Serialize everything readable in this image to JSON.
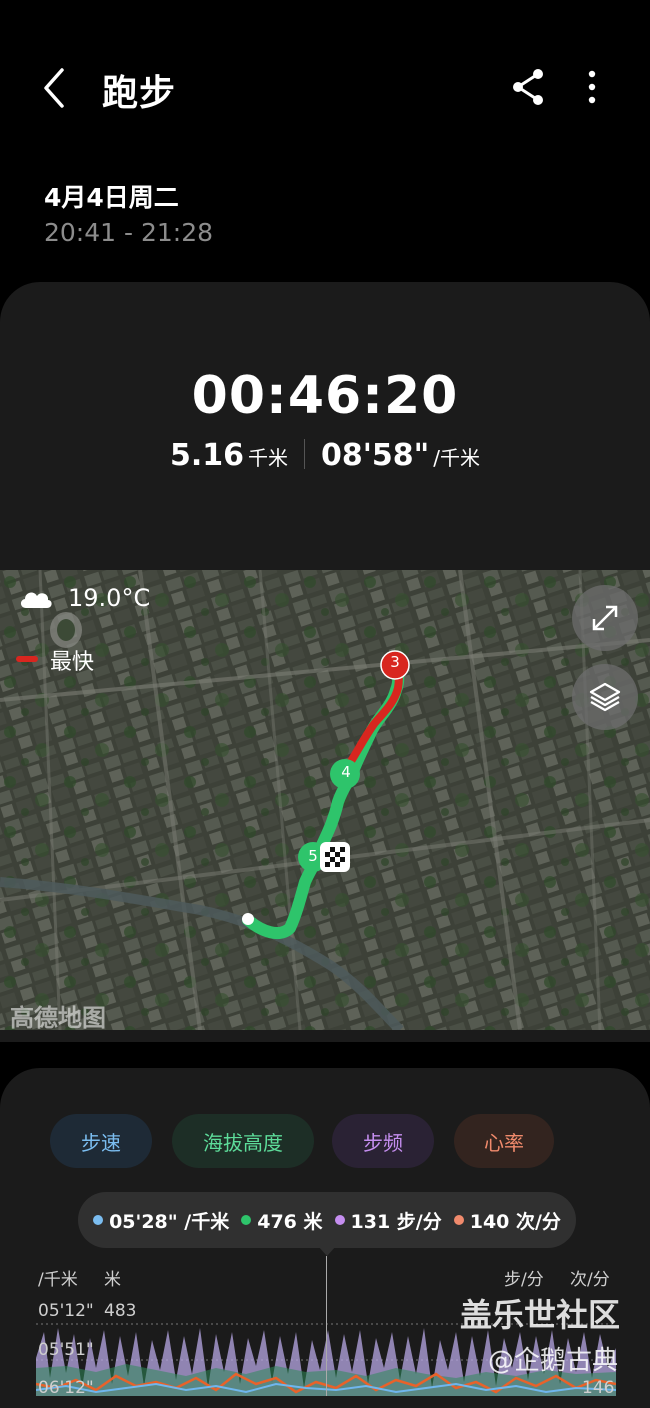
{
  "header": {
    "title": "跑步",
    "back_icon": "chevron-left-icon",
    "share_icon": "share-icon",
    "more_icon": "more-vertical-icon"
  },
  "session": {
    "date": "4月4日周二",
    "time_range": "20:41 - 21:28"
  },
  "summary": {
    "duration": "00:46:20",
    "distance_value": "5.16",
    "distance_unit": "千米",
    "pace_value": "08'58\"",
    "pace_unit": "/千米"
  },
  "map": {
    "weather_icon": "cloud-icon",
    "temperature": "19.0°C",
    "legend_label": "最快",
    "legend_color": "#d8261f",
    "route_color": "#2ec46b",
    "markers": [
      "3",
      "4",
      "5"
    ],
    "watermark": "高德地图",
    "expand_icon": "expand-icon",
    "layers_icon": "layers-icon"
  },
  "chart_tabs": [
    {
      "label": "步速",
      "color": "#7bbdf0"
    },
    {
      "label": "海拔高度",
      "color": "#5ddc9a"
    },
    {
      "label": "步频",
      "color": "#c58ef0"
    },
    {
      "label": "心率",
      "color": "#f08a6c"
    }
  ],
  "tooltip": {
    "pace": "05'28\" /千米",
    "altitude": "476 米",
    "cadence": "131 步/分",
    "heart_rate": "140 次/分"
  },
  "axes": {
    "pace_unit": "/千米",
    "alt_unit": "米",
    "cadence_unit": "步/分",
    "hr_unit": "次/分",
    "pace_tick_1": "05'12\"",
    "alt_tick_1": "483",
    "pace_tick_2": "05'51\"",
    "pace_tick_3": "06'12\"",
    "hr_tick_3": "146"
  },
  "watermarks": {
    "big": "盖乐世社区",
    "small": "@企鹅古典"
  }
}
